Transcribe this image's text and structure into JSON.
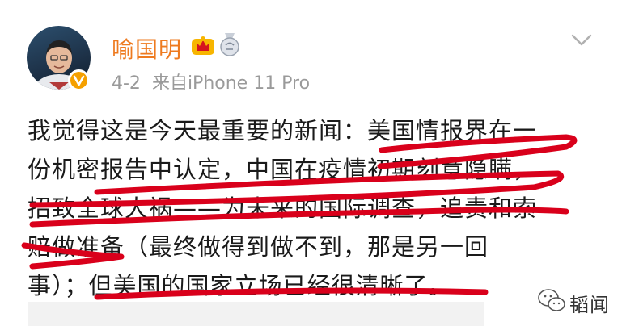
{
  "post": {
    "author": "喻国明",
    "date": "4-2",
    "source": "来自iPhone 11 Pro",
    "lines": [
      "我觉得这是今天最重要的新闻：美国情报界在一",
      "份机密报告中认定，中国在疫情初期刻意隐瞒，",
      "招致全球大祸——为未来的国际调查，追责和索",
      "赔做准备（最终做得到做不到，那是另一回",
      "事）；但美国的国家立场已经很清晰了。"
    ]
  },
  "badges": [
    "crown-vip-icon",
    "medal-icon"
  ],
  "icons": {
    "menu": "chevron-down-icon",
    "verified": "verified-v-icon"
  },
  "watermark": {
    "text": "韬闻"
  },
  "colors": {
    "username": "#ee7a1f",
    "underline": "#d9001b",
    "meta": "#9a9a9a",
    "verified": "#f5a000"
  }
}
